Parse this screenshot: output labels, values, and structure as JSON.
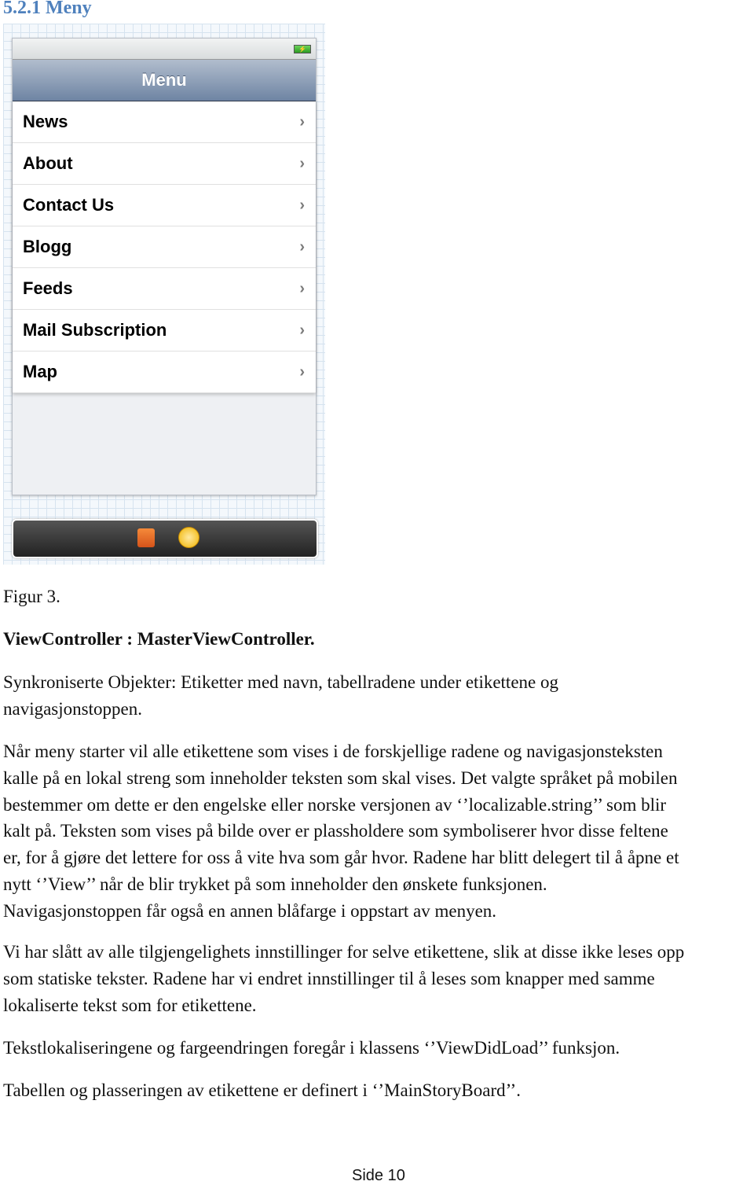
{
  "heading": "5.2.1 Meny",
  "mockup": {
    "nav_title": "Menu",
    "items": [
      "News",
      "About",
      "Contact Us",
      "Blogg",
      "Feeds",
      "Mail Subscription",
      "Map"
    ],
    "chevron": "›"
  },
  "caption": "Figur 3.",
  "subheading": "ViewController : MasterViewController.",
  "paragraphs": [
    [
      "Synkroniserte Objekter: Etiketter med navn, tabellradene under etikettene og",
      "navigasjonstoppen."
    ],
    [
      "Når meny starter vil alle etikettene som vises i de forskjellige radene og navigasjonsteksten",
      "kalle på en lokal streng som inneholder teksten som skal vises. Det valgte språket på mobilen",
      "bestemmer om dette er den engelske eller norske versjonen av ‘’localizable.string’’ som blir",
      "kalt på.  Teksten som vises på bilde over er plassholdere som symboliserer hvor disse feltene",
      "er, for å gjøre det lettere for oss å vite hva som går hvor. Radene har blitt delegert til å åpne et",
      "nytt ‘’View’’ når de blir trykket på som inneholder den ønskete funksjonen.",
      "Navigasjonstoppen får også en annen blåfarge i oppstart av menyen."
    ],
    [
      "Vi har slått av alle tilgjengelighets innstillinger for selve etikettene, slik at disse ikke leses opp",
      "som statiske tekster. Radene har vi endret innstillinger til å leses som knapper med samme",
      "lokaliserte tekst som for etikettene."
    ],
    [
      "Tekstlokaliseringene og fargeendringen foregår i klassens ‘’ViewDidLoad’’ funksjon."
    ],
    [
      "Tabellen og plasseringen av etikettene er definert i ‘’MainStoryBoard’’."
    ]
  ],
  "footer": "Side 10",
  "colors": {
    "heading": "#4f81bd",
    "navbar": "#7d90ac",
    "toolbar": "#333333"
  }
}
